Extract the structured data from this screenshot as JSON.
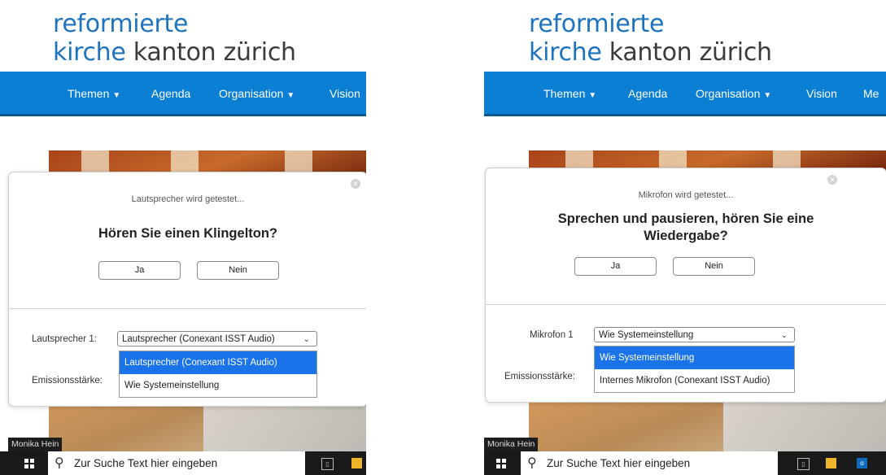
{
  "left": {
    "logo": {
      "line1": "reformierte",
      "line2_colored": "kirche",
      "line2_rest": " kanton zürich"
    },
    "nav": [
      {
        "label": "Themen",
        "has_caret": true
      },
      {
        "label": "Agenda",
        "has_caret": false
      },
      {
        "label": "Organisation",
        "has_caret": true
      },
      {
        "label": "Vision",
        "has_caret": false
      }
    ],
    "dialog": {
      "status": "Lautsprecher wird getestet...",
      "question": "Hören Sie einen Klingelton?",
      "yes_label": "Ja",
      "no_label": "Nein",
      "device_label": "Lautsprecher 1:",
      "selected_device": "Lautsprecher (Conexant ISST Audio)",
      "level_label": "Emissionsstärke:",
      "options": [
        "Lautsprecher (Conexant ISST Audio)",
        "Wie Systemeinstellung"
      ],
      "highlighted_option": 0
    },
    "participant_name": "Monika Hein",
    "taskbar": {
      "search_placeholder": "Zur Suche Text hier eingeben"
    }
  },
  "right": {
    "logo": {
      "line1": "reformierte",
      "line2_colored": "kirche",
      "line2_rest": " kanton zürich"
    },
    "nav": [
      {
        "label": "Themen",
        "has_caret": true
      },
      {
        "label": "Agenda",
        "has_caret": false
      },
      {
        "label": "Organisation",
        "has_caret": true
      },
      {
        "label": "Vision",
        "has_caret": false
      },
      {
        "label": "Me",
        "has_caret": false
      }
    ],
    "dialog": {
      "status": "Mikrofon wird getestet...",
      "question_line1": "Sprechen und pausieren, hören Sie eine",
      "question_line2": "Wiedergabe?",
      "yes_label": "Ja",
      "no_label": "Nein",
      "device_label": "Mikrofon 1",
      "selected_device": "Wie Systemeinstellung",
      "level_label": "Emissionsstärke:",
      "options": [
        "Wie Systemeinstellung",
        "Internes Mikrofon (Conexant ISST Audio)"
      ],
      "highlighted_option": 0
    },
    "participant_name": "Monika Hein",
    "taskbar": {
      "search_placeholder": "Zur Suche Text hier eingeben"
    }
  },
  "icons": {
    "close": "close-icon",
    "dropdown": "chevron-down-icon",
    "start": "windows-start-icon",
    "search": "search-icon",
    "task_view": "task-view-icon",
    "file_explorer": "file-explorer-icon",
    "outlook": "outlook-icon"
  },
  "colors": {
    "brand_blue": "#1e73be",
    "nav_blue": "#0a7fd4",
    "highlight": "#1a73e8",
    "taskbar": "#1a1a1a"
  }
}
